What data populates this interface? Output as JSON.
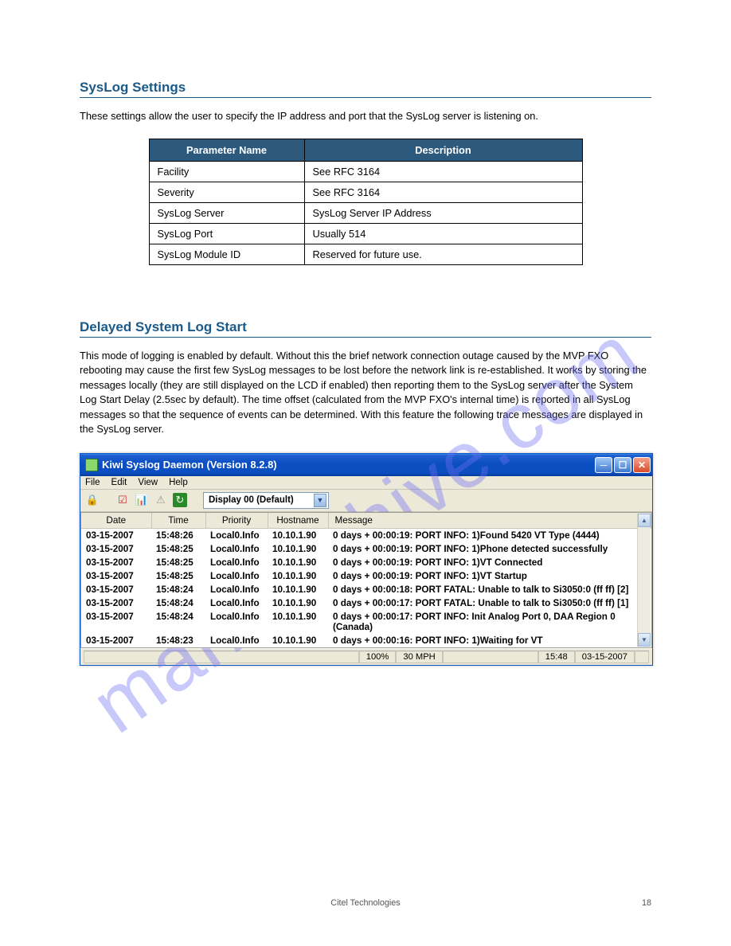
{
  "watermark": "manualshive.com",
  "sections": {
    "syslog": {
      "title": "SysLog Settings",
      "intro": "These settings allow the user to specify the IP address and port that the SysLog server is listening on.",
      "table": {
        "headers": [
          "Parameter Name",
          "Description"
        ],
        "rows": [
          [
            "Facility",
            "See RFC 3164"
          ],
          [
            "Severity",
            "See RFC 3164"
          ],
          [
            "SysLog Server",
            "SysLog Server IP Address"
          ],
          [
            "SysLog Port",
            "Usually 514"
          ],
          [
            "SysLog Module ID",
            "Reserved for future use."
          ]
        ]
      }
    },
    "delayed": {
      "title": "Delayed System Log Start",
      "body": "This mode of logging is enabled by default. Without this the brief network connection outage caused by the MVP FXO rebooting may cause the first few SysLog messages to be lost before the network link is re-established. It works by storing the messages locally (they are still displayed on the LCD if enabled) then reporting them to the SysLog server after the System Log Start Delay (2.5sec by default). The time offset (calculated from the MVP FXO's internal time) is reported in all SysLog messages so that the sequence of events can be determined. With this feature the following trace messages are displayed in the SysLog server."
    }
  },
  "app": {
    "title": "Kiwi Syslog Daemon (Version 8.2.8)",
    "menu": [
      "File",
      "Edit",
      "View",
      "Help"
    ],
    "combo": "Display 00 (Default)",
    "columns": [
      "Date",
      "Time",
      "Priority",
      "Hostname",
      "Message"
    ],
    "rows": [
      [
        "03-15-2007",
        "15:48:26",
        "Local0.Info",
        "10.10.1.90",
        "0 days + 00:00:19: PORT  INFO: 1)Found 5420 VT Type (4444)"
      ],
      [
        "03-15-2007",
        "15:48:25",
        "Local0.Info",
        "10.10.1.90",
        "0 days + 00:00:19: PORT  INFO: 1)Phone detected successfully"
      ],
      [
        "03-15-2007",
        "15:48:25",
        "Local0.Info",
        "10.10.1.90",
        "0 days + 00:00:19: PORT  INFO: 1)VT Connected"
      ],
      [
        "03-15-2007",
        "15:48:25",
        "Local0.Info",
        "10.10.1.90",
        "0 days + 00:00:19: PORT  INFO: 1)VT Startup"
      ],
      [
        "03-15-2007",
        "15:48:24",
        "Local0.Info",
        "10.10.1.90",
        "0 days + 00:00:18: PORT FATAL: Unable to talk to Si3050:0 (ff ff) [2]"
      ],
      [
        "03-15-2007",
        "15:48:24",
        "Local0.Info",
        "10.10.1.90",
        "0 days + 00:00:17: PORT FATAL: Unable to talk to Si3050:0 (ff ff) [1]"
      ],
      [
        "03-15-2007",
        "15:48:24",
        "Local0.Info",
        "10.10.1.90",
        "0 days + 00:00:17: PORT  INFO: Init Analog Port 0, DAA Region 0 (Canada)"
      ],
      [
        "03-15-2007",
        "15:48:23",
        "Local0.Info",
        "10.10.1.90",
        "0 days + 00:00:16: PORT  INFO: 1)Waiting for VT"
      ]
    ],
    "status": {
      "pct": "100%",
      "mph": "30 MPH",
      "time": "15:48",
      "date": "03-15-2007"
    }
  },
  "footer": {
    "center": "Citel Technologies",
    "right": "18"
  }
}
